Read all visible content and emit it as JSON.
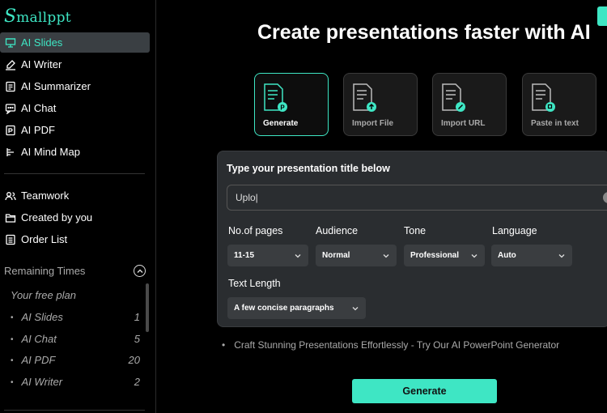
{
  "app": {
    "logo_initial": "S",
    "logo_rest": "mallppt"
  },
  "sidebar": {
    "items": [
      {
        "label": "AI Slides",
        "icon": "presentation-icon",
        "active": true
      },
      {
        "label": "AI Writer",
        "icon": "writer-icon"
      },
      {
        "label": "AI Summarizer",
        "icon": "summarizer-icon"
      },
      {
        "label": "AI Chat",
        "icon": "chat-icon"
      },
      {
        "label": "AI PDF",
        "icon": "pdf-icon"
      },
      {
        "label": "AI Mind Map",
        "icon": "mindmap-icon"
      }
    ],
    "secondary": [
      {
        "label": "Teamwork",
        "icon": "team-icon"
      },
      {
        "label": "Created by you",
        "icon": "folder-icon"
      },
      {
        "label": "Order List",
        "icon": "order-list-icon"
      }
    ],
    "remaining_label": "Remaining Times",
    "plan_title": "Your free plan",
    "plan_rows": [
      {
        "name": "AI Slides",
        "count": "1"
      },
      {
        "name": "AI Chat",
        "count": "5"
      },
      {
        "name": "AI PDF",
        "count": "20"
      },
      {
        "name": "AI Writer",
        "count": "2"
      }
    ]
  },
  "main": {
    "headline": "Create presentations faster with AI",
    "cards": [
      {
        "label": "Generate",
        "badge": "P",
        "active": true
      },
      {
        "label": "Import File",
        "badge": "up-arrow"
      },
      {
        "label": "Import URL",
        "badge": "link"
      },
      {
        "label": "Paste in text",
        "badge": "copy"
      }
    ],
    "panel": {
      "title": "Type your presentation title below",
      "input_value": "Uplo|",
      "fields": {
        "pages": {
          "label": "No.of pages",
          "value": "11-15"
        },
        "audience": {
          "label": "Audience",
          "value": "Normal"
        },
        "tone": {
          "label": "Tone",
          "value": "Professional"
        },
        "language": {
          "label": "Language",
          "value": "Auto"
        },
        "text_length": {
          "label": "Text Length",
          "value": "A few concise paragraphs"
        }
      }
    },
    "note": "Craft Stunning Presentations Effortlessly - Try Our AI PowerPoint Generator",
    "generate_button": "Generate"
  },
  "colors": {
    "accent": "#3ee6c4",
    "panel": "#2a2d30",
    "select": "#3a3d40"
  }
}
